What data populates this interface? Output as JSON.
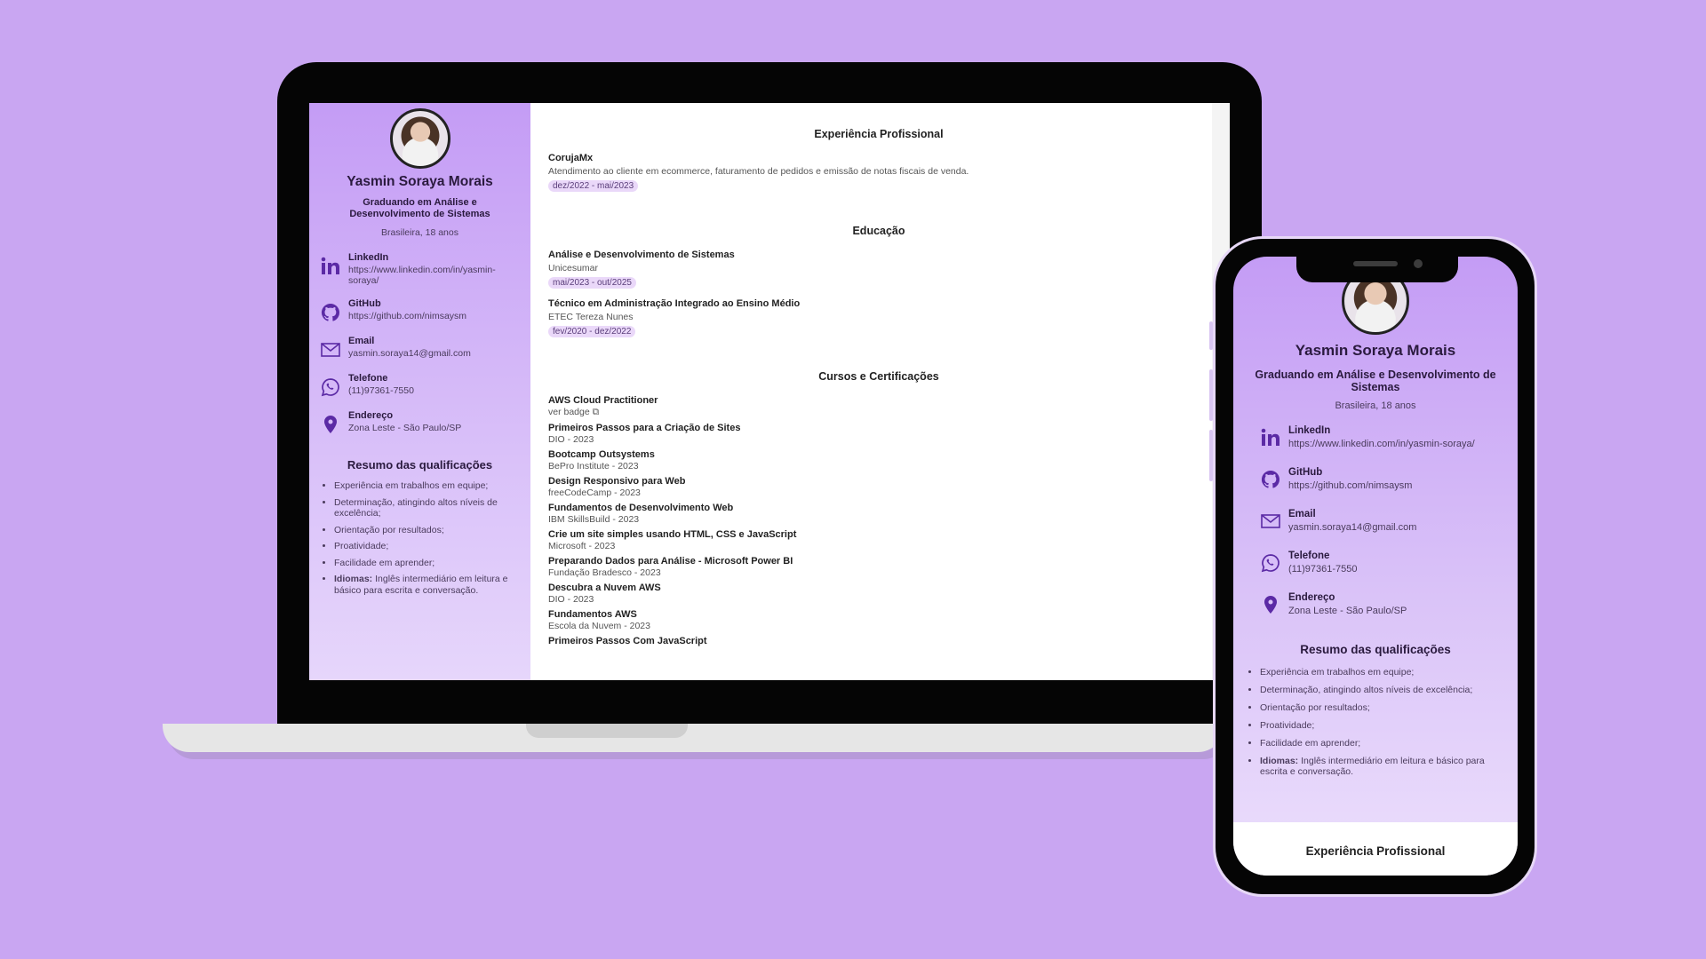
{
  "profile": {
    "name": "Yasmin Soraya Morais",
    "role": "Graduando em Análise e Desenvolvimento de Sistemas",
    "nationality": "Brasileira, 18 anos",
    "avatar_icon": "person-photo-icon"
  },
  "contacts": [
    {
      "title": "LinkedIn",
      "value": "https://www.linkedin.com/in/yasmin-soraya/",
      "icon": "linkedin-icon"
    },
    {
      "title": "GitHub",
      "value": "https://github.com/nimsaysm",
      "icon": "github-icon"
    },
    {
      "title": "Email",
      "value": "yasmin.soraya14@gmail.com",
      "icon": "mail-icon"
    },
    {
      "title": "Telefone",
      "value": "(11)97361-7550",
      "icon": "whatsapp-icon"
    },
    {
      "title": "Endereço",
      "value": "Zona Leste - São Paulo/SP",
      "icon": "location-pin-icon"
    }
  ],
  "qualifications": {
    "title": "Resumo das qualificações",
    "items": [
      "Experiência em trabalhos em equipe;",
      "Determinação, atingindo altos níveis de excelência;",
      "Orientação por resultados;",
      "Proatividade;",
      "Facilidade em aprender;"
    ],
    "languages_label": "Idiomas:",
    "languages_text": "Inglês intermediário em leitura e básico para escrita e conversação."
  },
  "experience": {
    "title": "Experiência Profissional",
    "items": [
      {
        "company": "CorujaMx",
        "description": "Atendimento ao cliente em ecommerce, faturamento de pedidos e emissão de notas fiscais de venda.",
        "period": "dez/2022 - mai/2023"
      }
    ]
  },
  "education": {
    "title": "Educação",
    "items": [
      {
        "course": "Análise e Desenvolvimento de Sistemas",
        "school": "Unicesumar",
        "period": "mai/2023 - out/2025"
      },
      {
        "course": "Técnico em Administração Integrado ao Ensino Médio",
        "school": "ETEC Tereza Nunes",
        "period": "fev/2020 - dez/2022"
      }
    ]
  },
  "courses": {
    "title": "Cursos e Certificações",
    "items": [
      {
        "name": "AWS Cloud Practitioner",
        "detail": "ver badge ⧉"
      },
      {
        "name": "Primeiros Passos para a Criação de Sites",
        "detail": "DIO - 2023"
      },
      {
        "name": "Bootcamp Outsystems",
        "detail": "BePro Institute - 2023"
      },
      {
        "name": "Design Responsivo para Web",
        "detail": "freeCodeCamp - 2023"
      },
      {
        "name": "Fundamentos de Desenvolvimento Web",
        "detail": "IBM SkillsBuild - 2023"
      },
      {
        "name": "Crie um site simples usando HTML, CSS e JavaScript",
        "detail": "Microsoft - 2023"
      },
      {
        "name": "Preparando Dados para Análise - Microsoft Power BI",
        "detail": "Fundação Bradesco - 2023"
      },
      {
        "name": "Descubra a Nuvem AWS",
        "detail": "DIO - 2023"
      },
      {
        "name": "Fundamentos AWS",
        "detail": "Escola da Nuvem - 2023"
      },
      {
        "name": "Primeiros Passos Com JavaScript",
        "detail": ""
      }
    ]
  },
  "colors": {
    "background": "#c9a6f2",
    "sidebar": "#c49cf5",
    "accent_icon": "#5b2aa5",
    "tag": "#ead8f9"
  }
}
